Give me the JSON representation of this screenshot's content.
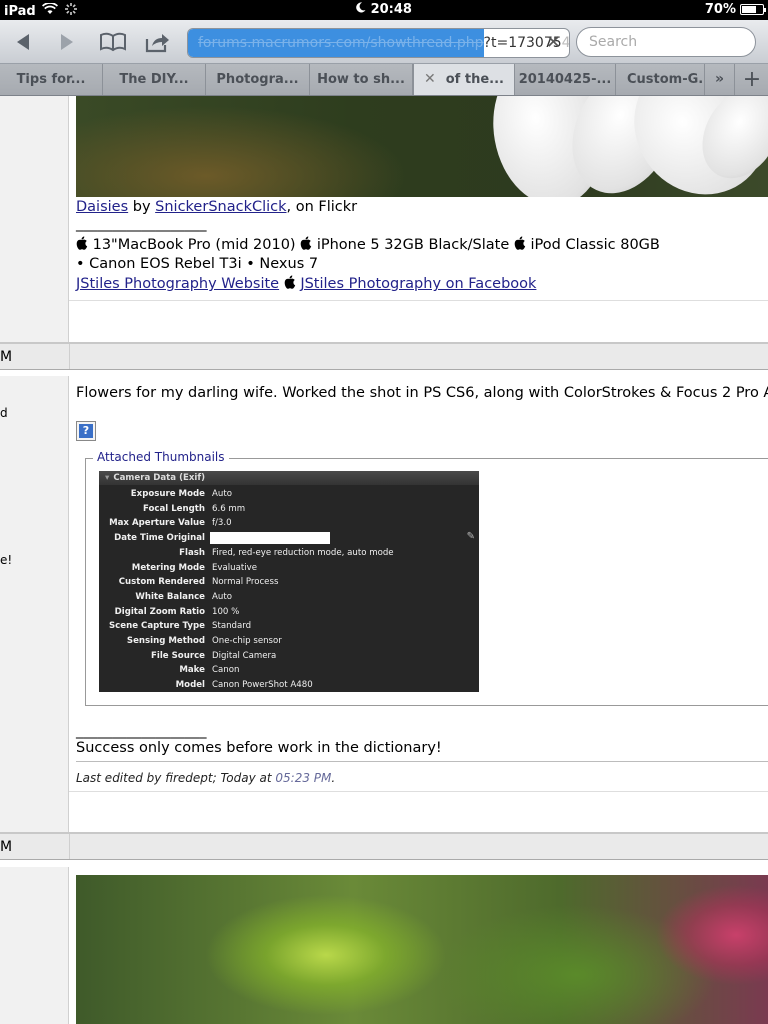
{
  "status_bar": {
    "device": "iPad",
    "time": "20:48",
    "battery_text": "70%",
    "battery_level": 0.7
  },
  "toolbar": {
    "url_selected": "forums.macrumors.com/showthread.php",
    "url_rest": "?t=173075",
    "url_fade": "4",
    "search_placeholder": "Search"
  },
  "tabs": [
    {
      "label": "Tips for..."
    },
    {
      "label": "The DIY..."
    },
    {
      "label": "Photogra..."
    },
    {
      "label": "How to sh..."
    },
    {
      "label": "of the...",
      "active": true
    },
    {
      "label": "20140425-..."
    },
    {
      "label": "Custom-G..."
    }
  ],
  "posts": {
    "post1": {
      "photo_link": "Daisies",
      "by": "by",
      "author_link": "SnickerSnackClick",
      "on_flickr": ", on Flickr",
      "sig_rule": "__________________",
      "sig_line1_a": "13\"MacBook Pro (mid 2010)",
      "sig_line1_b": "iPhone 5 32GB Black/Slate",
      "sig_line1_c": "iPod Classic 80GB",
      "sig_line2": "• Canon EOS Rebel T3i • Nexus 7",
      "website_link": "JStiles Photography Website",
      "facebook_link": "JStiles Photography on Facebook"
    },
    "post2": {
      "header_label": "M",
      "side_char1": "d",
      "side_char2": "e!",
      "body_text": "Flowers for my darling wife. Worked the shot in PS CS6, along with ColorStrokes & Focus 2 Pro A",
      "attached_legend": "Attached Thumbnails",
      "exif_title": "Camera Data (Exif)",
      "exif": [
        {
          "key": "Exposure Mode",
          "value": "Auto"
        },
        {
          "key": "Focal Length",
          "value": "6.6 mm"
        },
        {
          "key": "Max Aperture Value",
          "value": "f/3.0"
        },
        {
          "key": "Date Time Original",
          "value": ""
        },
        {
          "key": "Flash",
          "value": "Fired, red-eye reduction mode, auto mode"
        },
        {
          "key": "Metering Mode",
          "value": "Evaluative"
        },
        {
          "key": "Custom Rendered",
          "value": "Normal Process"
        },
        {
          "key": "White Balance",
          "value": "Auto"
        },
        {
          "key": "Digital Zoom Ratio",
          "value": "100 %"
        },
        {
          "key": "Scene Capture Type",
          "value": "Standard"
        },
        {
          "key": "Sensing Method",
          "value": "One-chip sensor"
        },
        {
          "key": "File Source",
          "value": "Digital Camera"
        },
        {
          "key": "Make",
          "value": "Canon"
        },
        {
          "key": "Model",
          "value": "Canon PowerShot A480"
        }
      ],
      "sig_rule": "__________________",
      "signature": "Success only comes before work in the dictionary!",
      "edited_prefix": "Last edited by firedept; Today at ",
      "edited_time": "05:23 PM",
      "edited_suffix": "."
    },
    "post3": {
      "header_label": "M"
    }
  }
}
